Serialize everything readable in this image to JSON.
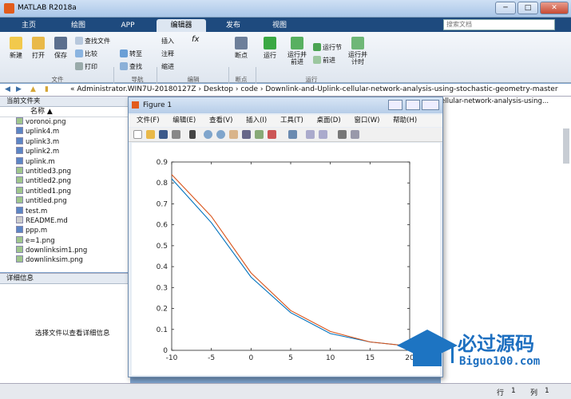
{
  "app": {
    "title": "MATLAB R2018a"
  },
  "window_controls": {
    "minimize": "─",
    "maximize": "□",
    "close": "✕"
  },
  "tabs": [
    {
      "label": "主页"
    },
    {
      "label": "绘图"
    },
    {
      "label": "APP"
    },
    {
      "label": "编辑器",
      "active": true
    },
    {
      "label": "发布"
    },
    {
      "label": "视图"
    }
  ],
  "search": {
    "placeholder": "搜索文档"
  },
  "ribbon": {
    "file_group": {
      "new": "新建",
      "open": "打开",
      "save": "保存",
      "find_files": "查找文件",
      "compare": "比较",
      "print": "打印",
      "label": "文件"
    },
    "nav_group": {
      "goto": "转至",
      "find": "查找",
      "label": "导航"
    },
    "edit_group": {
      "insert": "插入",
      "comment": "注释",
      "indent": "缩进",
      "fx": "fx",
      "label": "编辑"
    },
    "breakpoint_group": {
      "breakpoints": "断点",
      "label": "断点"
    },
    "run_group": {
      "run": "运行",
      "run_advance": "运行并\n前进",
      "run_section": "运行节",
      "advance": "前进",
      "run_time": "运行并\n计时",
      "label": "运行"
    }
  },
  "address": {
    "path": "« Administrator.WIN7U-20180127Z  ›  Desktop  ›  code  ›  Downlink-and-Uplink-cellular-network-analysis-using-stochastic-geometry-master"
  },
  "current_folder": {
    "header": "当前文件夹",
    "column": "名称 ▲",
    "files": [
      {
        "name": "voronoi.png",
        "type": "png"
      },
      {
        "name": "uplink4.m",
        "type": "m"
      },
      {
        "name": "uplink3.m",
        "type": "m"
      },
      {
        "name": "uplink2.m",
        "type": "m"
      },
      {
        "name": "uplink.m",
        "type": "m"
      },
      {
        "name": "untitled3.png",
        "type": "png"
      },
      {
        "name": "untitled2.png",
        "type": "png"
      },
      {
        "name": "untitled1.png",
        "type": "png"
      },
      {
        "name": "untitled.png",
        "type": "png"
      },
      {
        "name": "test.m",
        "type": "m"
      },
      {
        "name": "README.md",
        "type": "md"
      },
      {
        "name": "ppp.m",
        "type": "m"
      },
      {
        "name": "e=1.png",
        "type": "png"
      },
      {
        "name": "downlinksim1.png",
        "type": "png"
      },
      {
        "name": "downlinksim.png",
        "type": "png"
      }
    ]
  },
  "details": {
    "header": "详细信息",
    "hint": "选择文件以查看详细信息"
  },
  "right_panel": {
    "path_fragment": "ellular-network-analysis-using..."
  },
  "status": {
    "row_label": "行",
    "row": "1",
    "col_label": "列",
    "col": "1"
  },
  "figure": {
    "title": "Figure 1",
    "menu": [
      "文件(F)",
      "编辑(E)",
      "查看(V)",
      "插入(I)",
      "工具(T)",
      "桌面(D)",
      "窗口(W)",
      "帮助(H)"
    ]
  },
  "watermark": {
    "brand": "必过源码",
    "url": "Biguo100.com"
  },
  "chart_data": {
    "type": "line",
    "xlim": [
      -10,
      20
    ],
    "ylim": [
      0,
      0.9
    ],
    "xticks": [
      -10,
      -5,
      0,
      5,
      10,
      15,
      20
    ],
    "yticks": [
      0,
      0.1,
      0.2,
      0.3,
      0.4,
      0.5,
      0.6,
      0.7,
      0.8,
      0.9
    ],
    "x": [
      -10,
      -5,
      0,
      5,
      10,
      15,
      20
    ],
    "series": [
      {
        "color": "#0072bd",
        "values": [
          0.82,
          0.61,
          0.35,
          0.18,
          0.08,
          0.04,
          0.02
        ]
      },
      {
        "color": "#d95319",
        "values": [
          0.84,
          0.64,
          0.37,
          0.19,
          0.09,
          0.04,
          0.02
        ]
      }
    ],
    "grid": false
  }
}
